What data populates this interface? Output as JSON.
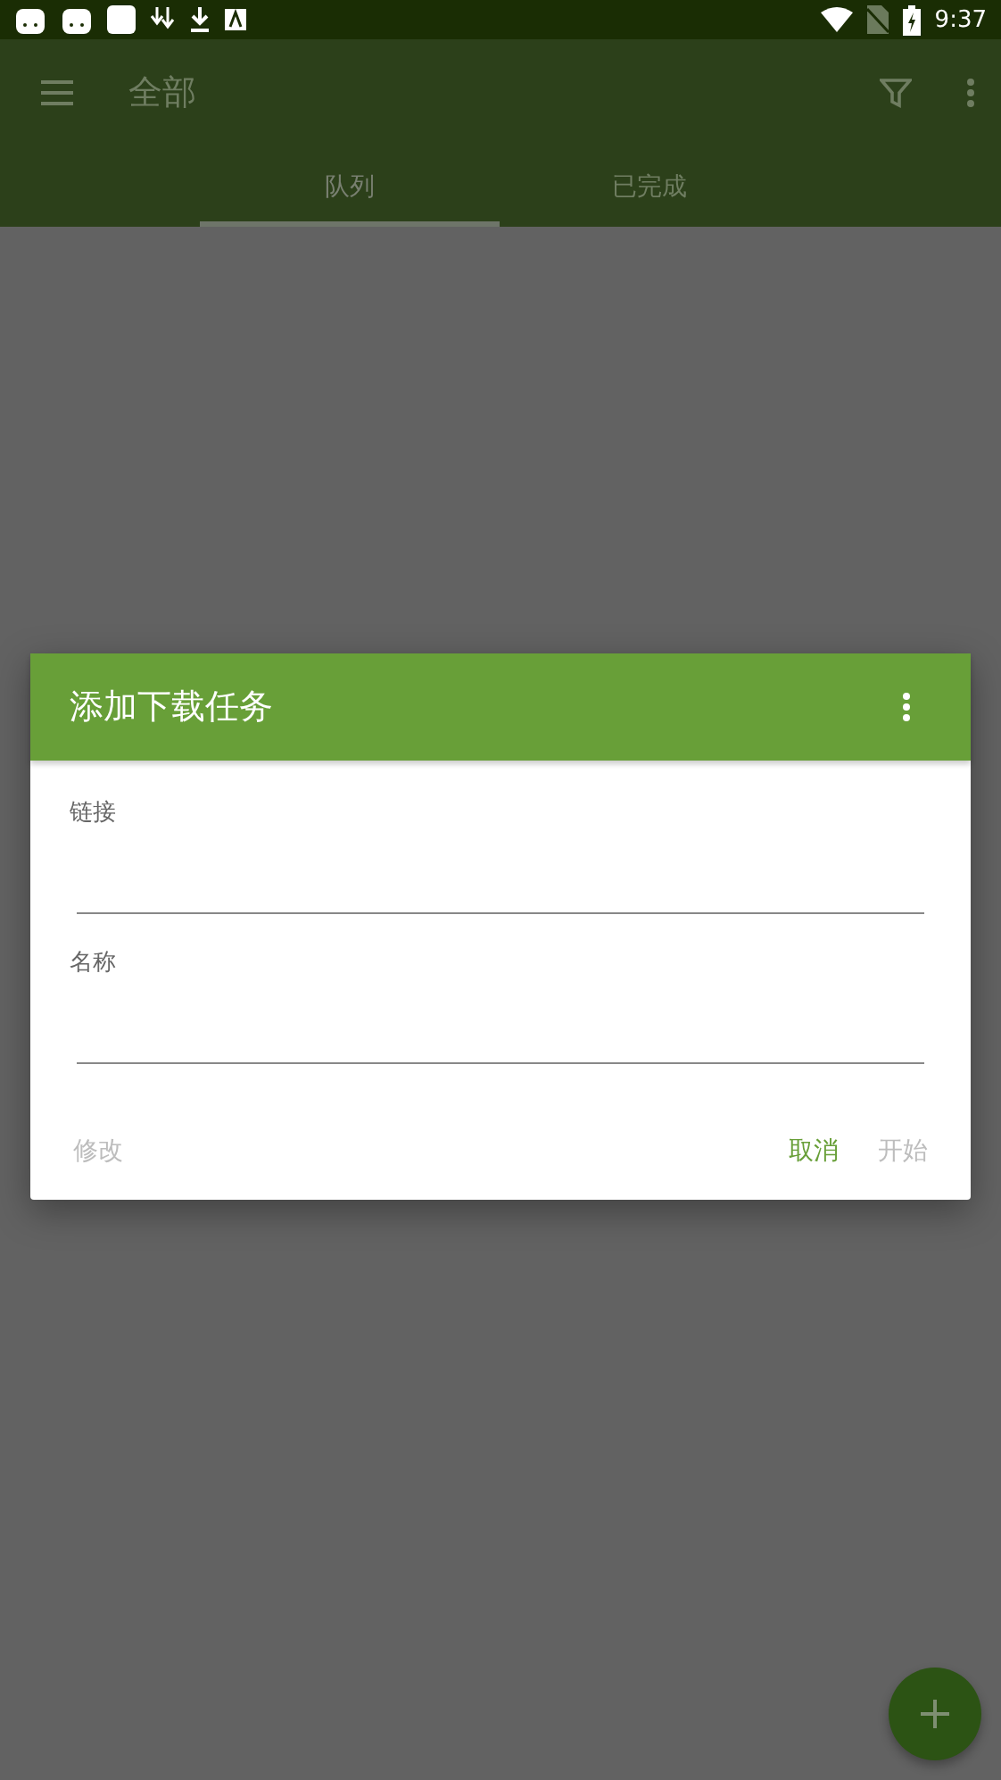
{
  "status_bar": {
    "time": "9:37"
  },
  "toolbar": {
    "title": "全部"
  },
  "tabs": [
    {
      "label": "队列",
      "selected": true
    },
    {
      "label": "已完成",
      "selected": false
    }
  ],
  "dialog": {
    "title": "添加下载任务",
    "fields": [
      {
        "label": "链接"
      },
      {
        "label": "名称"
      }
    ],
    "buttons": [
      {
        "label": "修改",
        "disabled": true
      },
      {
        "label": "取消",
        "disabled": false
      },
      {
        "label": "开始",
        "disabled": true
      }
    ]
  }
}
